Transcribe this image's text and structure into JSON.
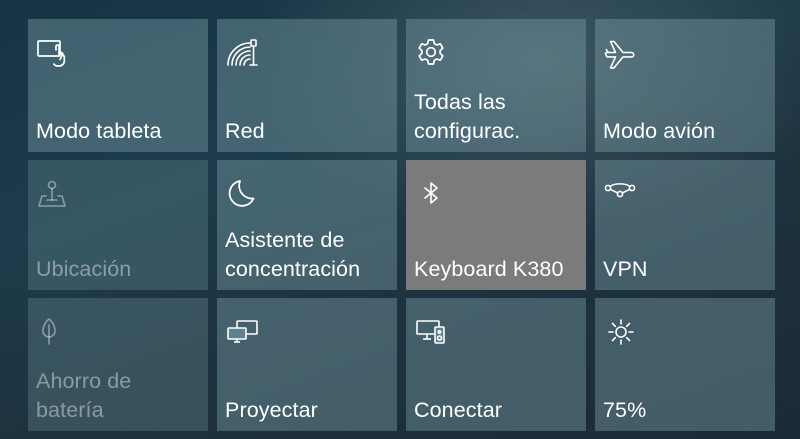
{
  "quick_actions": {
    "tiles": [
      {
        "label": "Modo tableta",
        "icon": "tablet-mode-icon",
        "state": "on"
      },
      {
        "label": "Red",
        "icon": "network-icon",
        "state": "on"
      },
      {
        "label": "Todas las\nconfigurac.",
        "icon": "settings-gear-icon",
        "state": "on"
      },
      {
        "label": "Modo avión",
        "icon": "airplane-icon",
        "state": "on"
      },
      {
        "label": "Ubicación",
        "icon": "location-icon",
        "state": "disabled"
      },
      {
        "label": "Asistente de\nconcentración",
        "icon": "moon-icon",
        "state": "on"
      },
      {
        "label": "Keyboard K380",
        "icon": "bluetooth-icon",
        "state": "active"
      },
      {
        "label": "VPN",
        "icon": "vpn-icon",
        "state": "on"
      },
      {
        "label": "Ahorro de\nbatería",
        "icon": "battery-saver-leaf-icon",
        "state": "disabled"
      },
      {
        "label": "Proyectar",
        "icon": "project-screen-icon",
        "state": "on"
      },
      {
        "label": "Conectar",
        "icon": "connect-devices-icon",
        "state": "on"
      },
      {
        "label": "75%",
        "icon": "brightness-sun-icon",
        "state": "on"
      }
    ]
  },
  "colors": {
    "tile": "#5f8794",
    "tile_disabled": "#3f6673",
    "tile_active": "#7b7b7b",
    "text": "#ffffff"
  }
}
